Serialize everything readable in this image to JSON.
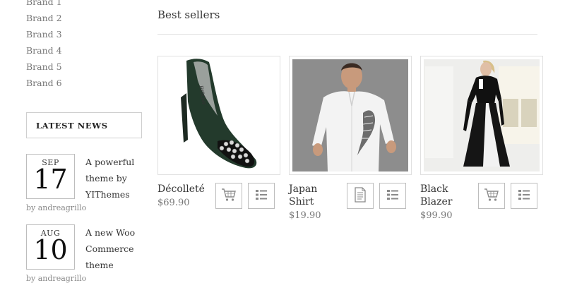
{
  "brands": [
    "Brand 1",
    "Brand 2",
    "Brand 3",
    "Brand 4",
    "Brand 5",
    "Brand 6"
  ],
  "latest_news": {
    "title": "LATEST NEWS",
    "items": [
      {
        "month": "SEP",
        "day": "17",
        "title": "A powerful theme by YIThemes",
        "author": "by andreagrillo"
      },
      {
        "month": "AUG",
        "day": "10",
        "title": "A new Woo Commerce theme",
        "author": "by andreagrillo"
      }
    ]
  },
  "best_sellers": {
    "title": "Best sellers",
    "products": [
      {
        "name": "Décolleté",
        "price": "$69.90",
        "primary_action_icon": "cart-icon",
        "secondary_action_icon": "details-icon"
      },
      {
        "name": "Japan Shirt",
        "price": "$19.90",
        "primary_action_icon": "document-icon",
        "secondary_action_icon": "details-icon"
      },
      {
        "name": "Black Blazer",
        "price": "$99.90",
        "primary_action_icon": "cart-icon",
        "secondary_action_icon": "details-icon"
      }
    ]
  },
  "colors": {
    "text_dark": "#333333",
    "text_muted": "#777777",
    "border": "#bdbdbd"
  }
}
